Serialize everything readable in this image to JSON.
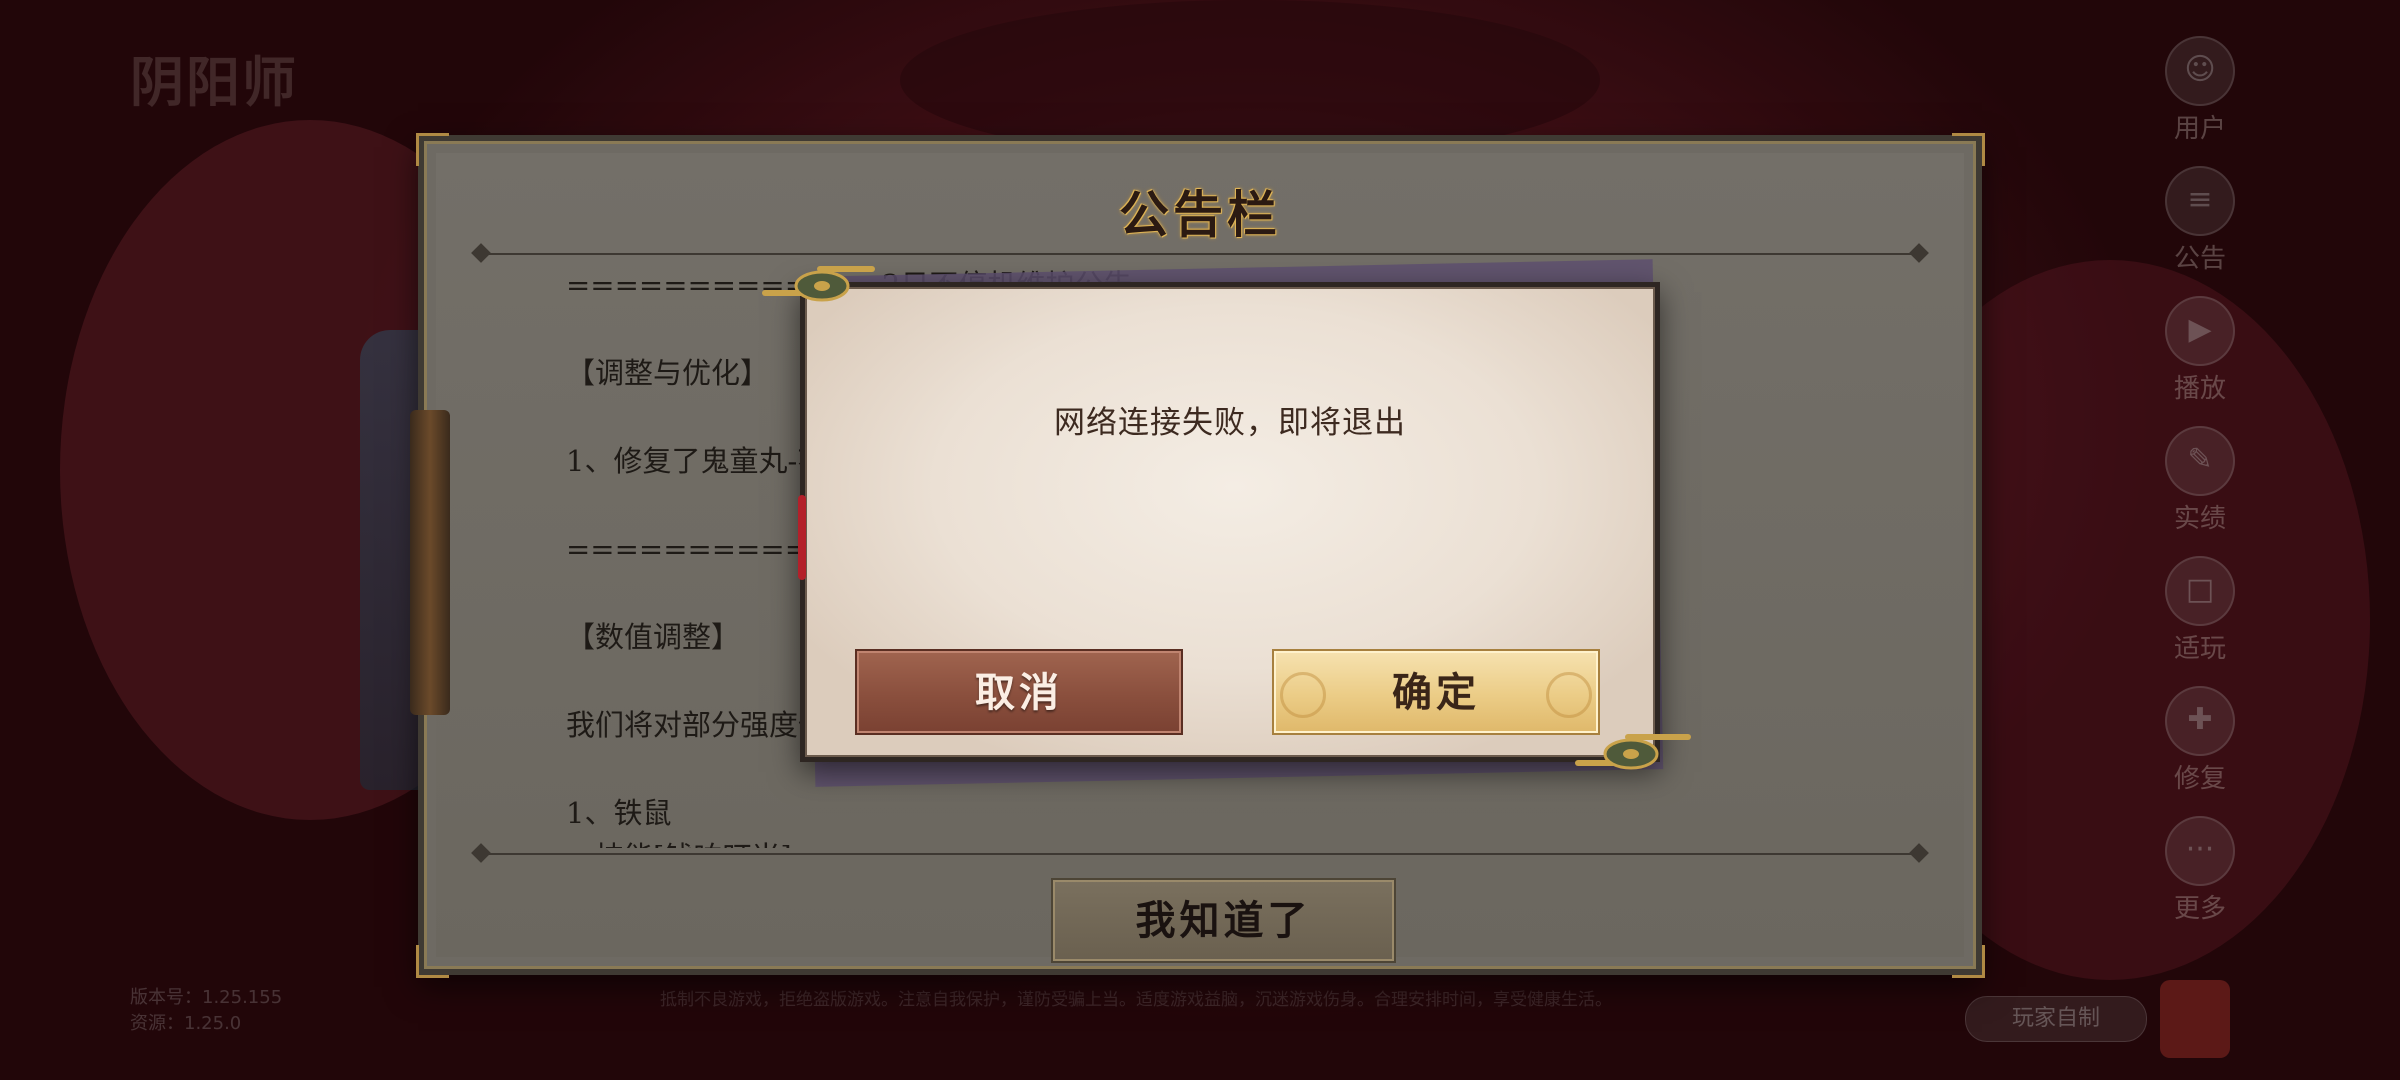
{
  "background": {
    "logo_text": "阴阳师",
    "side_menu": [
      {
        "icon": "user-icon",
        "glyph": "☺",
        "label": "用户"
      },
      {
        "icon": "notice-icon",
        "glyph": "≡",
        "label": "公告"
      },
      {
        "icon": "replay-icon",
        "glyph": "▶",
        "label": "播放"
      },
      {
        "icon": "record-icon",
        "glyph": "✎",
        "label": "实绩"
      },
      {
        "icon": "play-icon",
        "glyph": "□",
        "label": "适玩"
      },
      {
        "icon": "repair-icon",
        "glyph": "✚",
        "label": "修复"
      },
      {
        "icon": "more-icon",
        "glyph": "···",
        "label": "更多"
      }
    ],
    "version_label": "版本号：1.25.155",
    "resource_label": "资源：1.25.0",
    "bottom_notice": "抵制不良游戏，拒绝盗版游戏。注意自我保护，谨防受骗上当。适度游戏益脑，沉迷游戏伤身。合理安排时间，享受健康生活。",
    "studio_button": "玩家自制"
  },
  "board": {
    "title": "公告栏",
    "lines": [
      "=============2日不停机维护公告=============",
      "",
      "【调整与优化】",
      "",
      "1、修复了鬼童丸-花焚雨皮肤上架活动描述错误的问题。",
      "",
      "============3月12日不停机维护公告============",
      "",
      "【数值调整】",
      "",
      "我们将对部分强度偏高的式神进行数值调整",
      "",
      "1、铁鼠",
      "一技能[钱响叮当]"
    ],
    "ack_button": "我知道了"
  },
  "dialog": {
    "message": "网络连接失败，即将退出",
    "cancel_label": "取消",
    "confirm_label": "确定"
  },
  "colors": {
    "board_bg": "#6e6a63",
    "title_gold": "#e3b85a",
    "cancel_red": "#8a4f3d",
    "confirm_gold": "#ebcc86"
  }
}
